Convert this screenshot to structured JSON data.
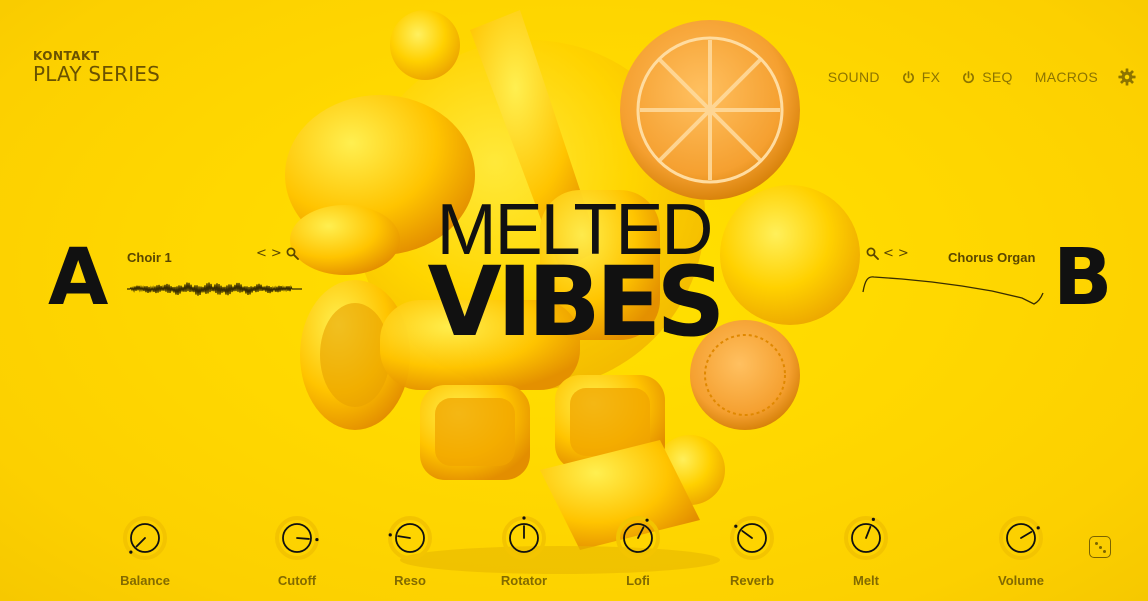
{
  "brand": {
    "top": "KONTAKT",
    "bottom": "PLAY SERIES"
  },
  "nav": {
    "sound": "SOUND",
    "fx": "FX",
    "seq": "SEQ",
    "macros": "MACROS"
  },
  "title": {
    "line1": "MELTED",
    "line2": "VIBES"
  },
  "slot_a": {
    "letter": "A",
    "name": "Choir 1",
    "prev": "<",
    "next": ">"
  },
  "slot_b": {
    "letter": "B",
    "name": "Chorus Organ",
    "prev": "<",
    "next": ">"
  },
  "knobs": [
    {
      "label": "Balance",
      "value": 0.0
    },
    {
      "label": "Cutoff",
      "value": 0.85
    },
    {
      "label": "Reso",
      "value": 0.2
    },
    {
      "label": "Rotator",
      "value": 0.5
    },
    {
      "label": "Lofi",
      "value": 0.6
    },
    {
      "label": "Reverb",
      "value": 0.3
    },
    {
      "label": "Melt",
      "value": 0.58
    },
    {
      "label": "Volume",
      "value": 0.72
    }
  ],
  "colors": {
    "background": "#ffd800",
    "text_dark": "#111111",
    "ui_brown": "#7b6400"
  },
  "icons": {
    "power": "power-icon",
    "settings": "gear-icon",
    "search": "search-icon",
    "randomize": "dice-icon"
  }
}
